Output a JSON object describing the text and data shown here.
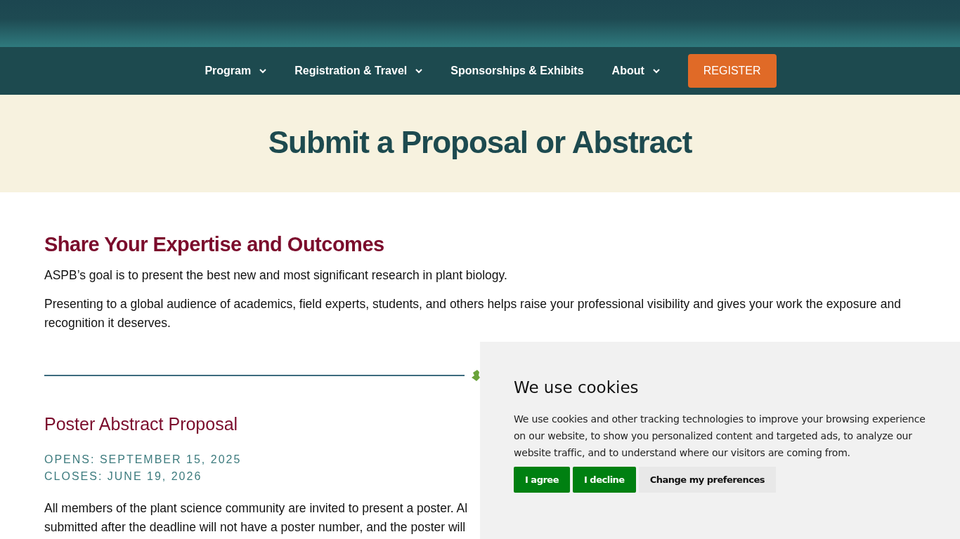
{
  "nav": {
    "items": [
      {
        "label": "Program",
        "dropdown": true
      },
      {
        "label": "Registration & Travel",
        "dropdown": true
      },
      {
        "label": "Sponsorships & Exhibits",
        "dropdown": false
      },
      {
        "label": "About",
        "dropdown": true
      }
    ],
    "cta": "REGISTER"
  },
  "hero": {
    "title": "Submit a Proposal or Abstract"
  },
  "intro": {
    "heading": "Share Your Expertise and Outcomes",
    "paragraphs": [
      "ASPB’s goal is to present the best new and most significant research in plant biology.",
      "Presenting to a global audience of academics, field experts, students, and others helps raise your professional visibility and gives your work the exposure and recognition it deserves."
    ]
  },
  "section": {
    "heading": "Poster Abstract Proposal",
    "dates": [
      "OPENS: SEPTEMBER 15, 2025",
      "CLOSES: JUNE 19, 2026"
    ],
    "lines": [
      "All members of the plant science community are invited to present a poster. Al",
      "submitted after the deadline will not have a poster number, and the poster will"
    ]
  },
  "cookies": {
    "title": "We use cookies",
    "text": "We use cookies and other tracking technologies to improve your browsing experience on our website, to show you personalized content and targeted ads, to analyze our website traffic, and to understand where our visitors are coming from.",
    "buttons": [
      {
        "label": "I agree",
        "kind": "primary"
      },
      {
        "label": "I decline",
        "kind": "primary"
      },
      {
        "label": "Change my preferences",
        "kind": "secondary"
      }
    ]
  }
}
